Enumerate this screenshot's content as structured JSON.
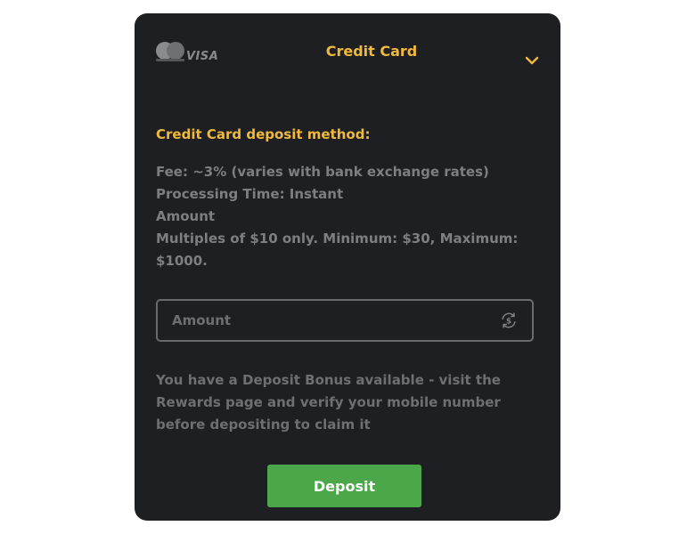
{
  "header": {
    "title": "Credit Card",
    "brand_visa": "VISA",
    "logos": [
      "mastercard-icon",
      "visa-icon"
    ],
    "expand_icon": "chevron-down-icon"
  },
  "method": {
    "title": "Credit Card deposit method:",
    "fee": "Fee: ~3% (varies with bank exchange rates)",
    "processing": "Processing Time: Instant",
    "amount_label": "Amount",
    "limits_line1": "Multiples of $10 only. Minimum: $30, Maximum:",
    "limits_line2": "$1000."
  },
  "amount_field": {
    "placeholder": "Amount",
    "value": "",
    "icon": "currency-exchange-icon"
  },
  "bonus": {
    "line1": "You have a Deposit Bonus available - visit the",
    "line2": "Rewards page and verify your mobile number",
    "line3": "before depositing to claim it"
  },
  "actions": {
    "deposit_label": "Deposit"
  },
  "colors": {
    "accent": "#f0b93a",
    "panel": "#1e1f23",
    "button": "#4ca74a",
    "muted_text": "#7d7e82"
  }
}
